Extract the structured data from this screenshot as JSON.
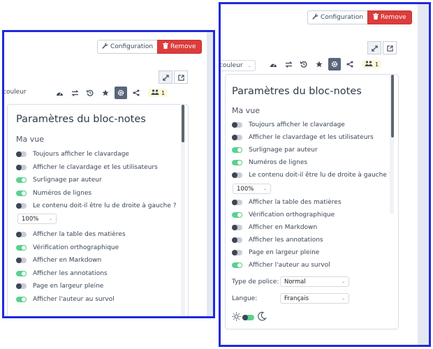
{
  "buttons": {
    "configuration": "Configuration",
    "remove": "Remove"
  },
  "toolbar": {
    "color_select": "couleur",
    "users_count": "1"
  },
  "panel": {
    "title": "Paramètres du bloc-notes",
    "section": "Ma vue",
    "options": [
      {
        "label": "Toujours afficher le clavardage",
        "enabled": false
      },
      {
        "label": "Afficher le clavardage et les utilisateurs",
        "enabled": false
      },
      {
        "label": "Surlignage par auteur",
        "enabled": true
      },
      {
        "label": "Numéros de lignes",
        "enabled": true
      },
      {
        "label": "Le contenu doit-il être lu de droite à gauche ?",
        "enabled": false
      }
    ],
    "zoom": "100%",
    "options2": [
      {
        "label": "Afficher la table des matières",
        "enabled": false
      },
      {
        "label": "Vérification orthographique",
        "enabled": true
      },
      {
        "label": "Afficher en Markdown",
        "enabled": false
      },
      {
        "label": "Afficher les annotations",
        "enabled": true
      },
      {
        "label": "Page en largeur pleine",
        "enabled": false
      },
      {
        "label": "Afficher l'auteur au survol",
        "enabled": true
      }
    ],
    "font_label": "Type de police:",
    "font_value": "Normal",
    "language_label": "Langue:",
    "language_value": "Français"
  },
  "colors": {
    "frame_border": "#1f2ae0",
    "remove_bg": "#dc3c3c",
    "toggle_on": "#5ad18e",
    "toggle_off": "#3e4655"
  }
}
